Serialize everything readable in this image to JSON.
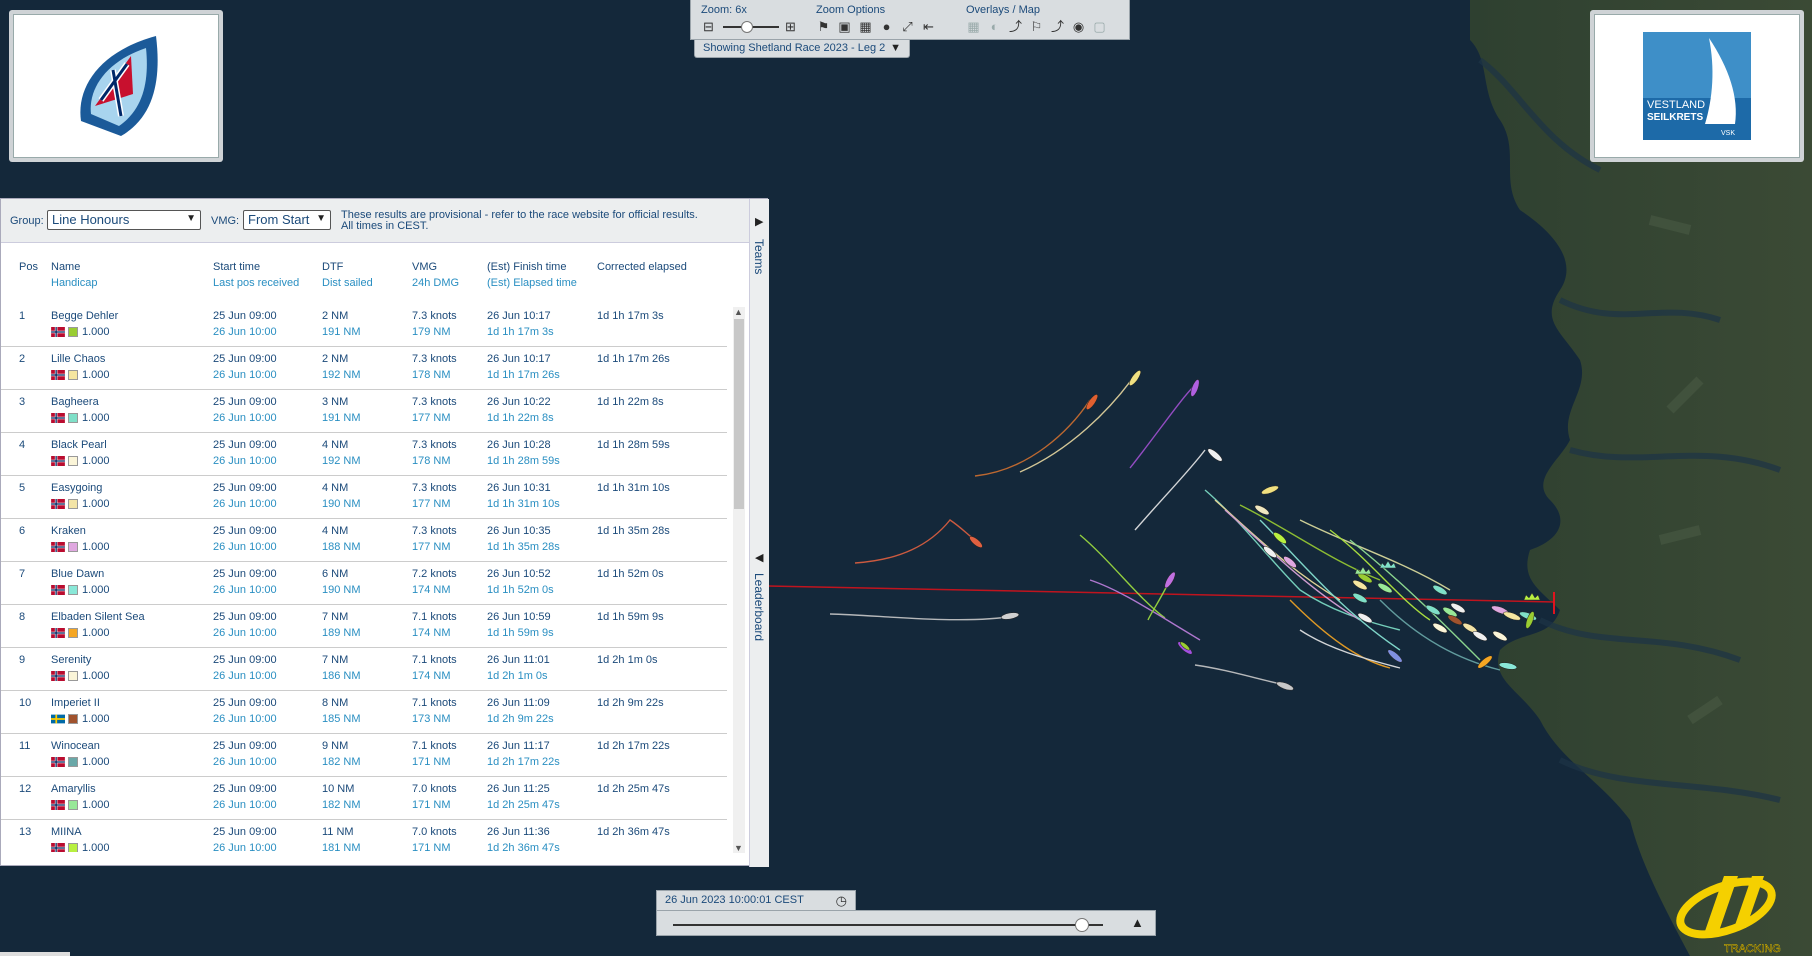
{
  "toolbar": {
    "zoom_label": "Zoom: 6x",
    "zoom_options_label": "Zoom Options",
    "overlays_label": "Overlays / Map",
    "race_select": "Showing Shetland Race 2023 - Leg 2"
  },
  "panel": {
    "group_label": "Group:",
    "group_value": "Line Honours",
    "vmg_label": "VMG:",
    "vmg_value": "From Start",
    "notice_line1": "These results are provisional - refer to the race website for official results.",
    "notice_line2": "All times in CEST.",
    "tab_teams": "Teams",
    "tab_leaderboard": "Leaderboard"
  },
  "columns": {
    "pos": "Pos",
    "name": "Name",
    "handicap": "Handicap",
    "start_time": "Start time",
    "last_pos": "Last pos received",
    "dtf": "DTF",
    "dist_sailed": "Dist sailed",
    "vmg": "VMG",
    "dmg": "24h DMG",
    "finish_time": "(Est) Finish time",
    "elapsed_time": "(Est) Elapsed time",
    "corrected": "Corrected elapsed"
  },
  "rows": [
    {
      "pos": "1",
      "name": "Begge Dehler",
      "flag": "NOR",
      "color": "#9acd32",
      "handicap": "1.000",
      "start": "25 Jun 09:00",
      "last": "26 Jun 10:00",
      "dtf": "2 NM",
      "dist": "191 NM",
      "vmg": "7.3 knots",
      "dmg": "179 NM",
      "finish": "26 Jun 10:17",
      "elapsed": "1d 1h 17m 3s",
      "corrected": "1d 1h 17m 3s"
    },
    {
      "pos": "2",
      "name": "Lille Chaos",
      "flag": "NOR",
      "color": "#f5e6a0",
      "handicap": "1.000",
      "start": "25 Jun 09:00",
      "last": "26 Jun 10:00",
      "dtf": "2 NM",
      "dist": "192 NM",
      "vmg": "7.3 knots",
      "dmg": "178 NM",
      "finish": "26 Jun 10:17",
      "elapsed": "1d 1h 17m 26s",
      "corrected": "1d 1h 17m 26s"
    },
    {
      "pos": "3",
      "name": "Bagheera",
      "flag": "NOR",
      "color": "#7fe0c8",
      "handicap": "1.000",
      "start": "25 Jun 09:00",
      "last": "26 Jun 10:00",
      "dtf": "3 NM",
      "dist": "191 NM",
      "vmg": "7.3 knots",
      "dmg": "177 NM",
      "finish": "26 Jun 10:22",
      "elapsed": "1d 1h 22m 8s",
      "corrected": "1d 1h 22m 8s"
    },
    {
      "pos": "4",
      "name": "Black Pearl",
      "flag": "NOR",
      "color": "#fbf5d8",
      "handicap": "1.000",
      "start": "25 Jun 09:00",
      "last": "26 Jun 10:00",
      "dtf": "4 NM",
      "dist": "192 NM",
      "vmg": "7.3 knots",
      "dmg": "178 NM",
      "finish": "26 Jun 10:28",
      "elapsed": "1d 1h 28m 59s",
      "corrected": "1d 1h 28m 59s"
    },
    {
      "pos": "5",
      "name": "Easygoing",
      "flag": "NOR",
      "color": "#f3e4a6",
      "handicap": "1.000",
      "start": "25 Jun 09:00",
      "last": "26 Jun 10:00",
      "dtf": "4 NM",
      "dist": "190 NM",
      "vmg": "7.3 knots",
      "dmg": "177 NM",
      "finish": "26 Jun 10:31",
      "elapsed": "1d 1h 31m 10s",
      "corrected": "1d 1h 31m 10s"
    },
    {
      "pos": "6",
      "name": "Kraken",
      "flag": "NOR",
      "color": "#e0a8e0",
      "handicap": "1.000",
      "start": "25 Jun 09:00",
      "last": "26 Jun 10:00",
      "dtf": "4 NM",
      "dist": "188 NM",
      "vmg": "7.3 knots",
      "dmg": "177 NM",
      "finish": "26 Jun 10:35",
      "elapsed": "1d 1h 35m 28s",
      "corrected": "1d 1h 35m 28s"
    },
    {
      "pos": "7",
      "name": "Blue Dawn",
      "flag": "NOR",
      "color": "#8ae8d8",
      "handicap": "1.000",
      "start": "25 Jun 09:00",
      "last": "26 Jun 10:00",
      "dtf": "6 NM",
      "dist": "190 NM",
      "vmg": "7.2 knots",
      "dmg": "174 NM",
      "finish": "26 Jun 10:52",
      "elapsed": "1d 1h 52m 0s",
      "corrected": "1d 1h 52m 0s"
    },
    {
      "pos": "8",
      "name": "Elbaden Silent Sea",
      "flag": "NOR",
      "color": "#f5a623",
      "handicap": "1.000",
      "start": "25 Jun 09:00",
      "last": "26 Jun 10:00",
      "dtf": "7 NM",
      "dist": "189 NM",
      "vmg": "7.1 knots",
      "dmg": "174 NM",
      "finish": "26 Jun 10:59",
      "elapsed": "1d 1h 59m 9s",
      "corrected": "1d 1h 59m 9s"
    },
    {
      "pos": "9",
      "name": "Serenity",
      "flag": "NOR",
      "color": "#fbf5d8",
      "handicap": "1.000",
      "start": "25 Jun 09:00",
      "last": "26 Jun 10:00",
      "dtf": "7 NM",
      "dist": "186 NM",
      "vmg": "7.1 knots",
      "dmg": "174 NM",
      "finish": "26 Jun 11:01",
      "elapsed": "1d 2h 1m 0s",
      "corrected": "1d 2h 1m 0s"
    },
    {
      "pos": "10",
      "name": "Imperiet II",
      "flag": "SWE",
      "color": "#a0522d",
      "handicap": "1.000",
      "start": "25 Jun 09:00",
      "last": "26 Jun 10:00",
      "dtf": "8 NM",
      "dist": "185 NM",
      "vmg": "7.1 knots",
      "dmg": "173 NM",
      "finish": "26 Jun 11:09",
      "elapsed": "1d 2h 9m 22s",
      "corrected": "1d 2h 9m 22s"
    },
    {
      "pos": "11",
      "name": "Winocean",
      "flag": "NOR",
      "color": "#6aa8a8",
      "handicap": "1.000",
      "start": "25 Jun 09:00",
      "last": "26 Jun 10:00",
      "dtf": "9 NM",
      "dist": "182 NM",
      "vmg": "7.1 knots",
      "dmg": "171 NM",
      "finish": "26 Jun 11:17",
      "elapsed": "1d 2h 17m 22s",
      "corrected": "1d 2h 17m 22s"
    },
    {
      "pos": "12",
      "name": "Amaryllis",
      "flag": "NOR",
      "color": "#98e898",
      "handicap": "1.000",
      "start": "25 Jun 09:00",
      "last": "26 Jun 10:00",
      "dtf": "10 NM",
      "dist": "182 NM",
      "vmg": "7.0 knots",
      "dmg": "171 NM",
      "finish": "26 Jun 11:25",
      "elapsed": "1d 2h 25m 47s",
      "corrected": "1d 2h 25m 47s"
    },
    {
      "pos": "13",
      "name": "MIINA",
      "flag": "NOR",
      "color": "#b8f040",
      "handicap": "1.000",
      "start": "25 Jun 09:00",
      "last": "26 Jun 10:00",
      "dtf": "11 NM",
      "dist": "181 NM",
      "vmg": "7.0 knots",
      "dmg": "171 NM",
      "finish": "26 Jun 11:36",
      "elapsed": "1d 2h 36m 47s",
      "corrected": "1d 2h 36m 47s"
    }
  ],
  "time": {
    "current": "26 Jun 2023 10:00:01 CEST",
    "progress": 0.95
  },
  "logos": {
    "right_line1": "VESTLAND",
    "right_line2": "SEILKRETS",
    "right_line3": "VSK",
    "yb_text": "TRACKING"
  },
  "colors": {
    "accent": "#1b4a7a",
    "link": "#2a8fc2",
    "sea": "#14283a",
    "course_line": "#c0141e"
  }
}
